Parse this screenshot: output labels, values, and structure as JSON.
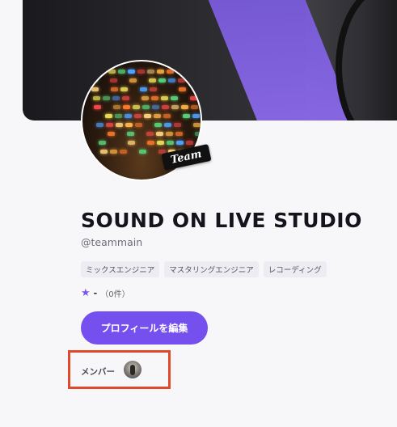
{
  "profile": {
    "team_badge": "Team",
    "name": "SOUND ON LIVE STUDIO",
    "handle": "@teammain",
    "tags": [
      "ミックスエンジニア",
      "マスタリングエンジニア",
      "レコーディング"
    ],
    "rating_value": "-",
    "rating_count": "（0件）",
    "edit_button": "プロフィールを編集",
    "members_label": "メンバー"
  },
  "colors": {
    "accent": "#7650ee",
    "highlight_box": "#e1492b"
  },
  "icons": {
    "star": "star-icon"
  }
}
